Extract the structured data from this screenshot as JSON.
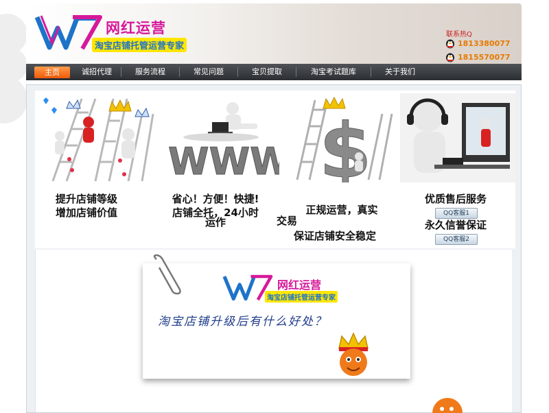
{
  "brand": {
    "name": "网红运营",
    "slogan": "淘宝店铺托管运营专家"
  },
  "contact": {
    "title": "联系热Q",
    "qq_numbers": [
      "1813380077",
      "1815570077"
    ]
  },
  "nav": {
    "items": [
      "主页",
      "诚招代理",
      "服务流程",
      "常见问题",
      "宝贝提取",
      "淘宝考试题库",
      "关于我们"
    ],
    "active_index": 0
  },
  "features": [
    {
      "icon": "ladder-crown-icon",
      "lines": [
        "提升店铺等级",
        "增加店铺价值"
      ]
    },
    {
      "icon": "www-laptop-icon",
      "lines": [
        "省心！方便！快捷!",
        "店铺全托，24小时",
        "运作"
      ]
    },
    {
      "icon": "dollar-ladder-icon",
      "lines": [
        "正规运营，真实",
        "交易",
        "保证店铺安全稳定"
      ]
    },
    {
      "icon": "headset-support-icon",
      "lines": [
        "优质售后服务",
        "永久信誉保证"
      ]
    }
  ],
  "qq_buttons": [
    "QQ客服1",
    "QQ客服2"
  ],
  "promo": {
    "brand_name": "网红运营",
    "slogan": "淘宝店铺托管运营专家",
    "question": "淘宝店铺升级后有什么好处？"
  },
  "colors": {
    "brand_pink": "#d6199a",
    "brand_blue": "#1e73c9",
    "nav_active": "#f05a0a",
    "qq_number": "#e67a00"
  }
}
